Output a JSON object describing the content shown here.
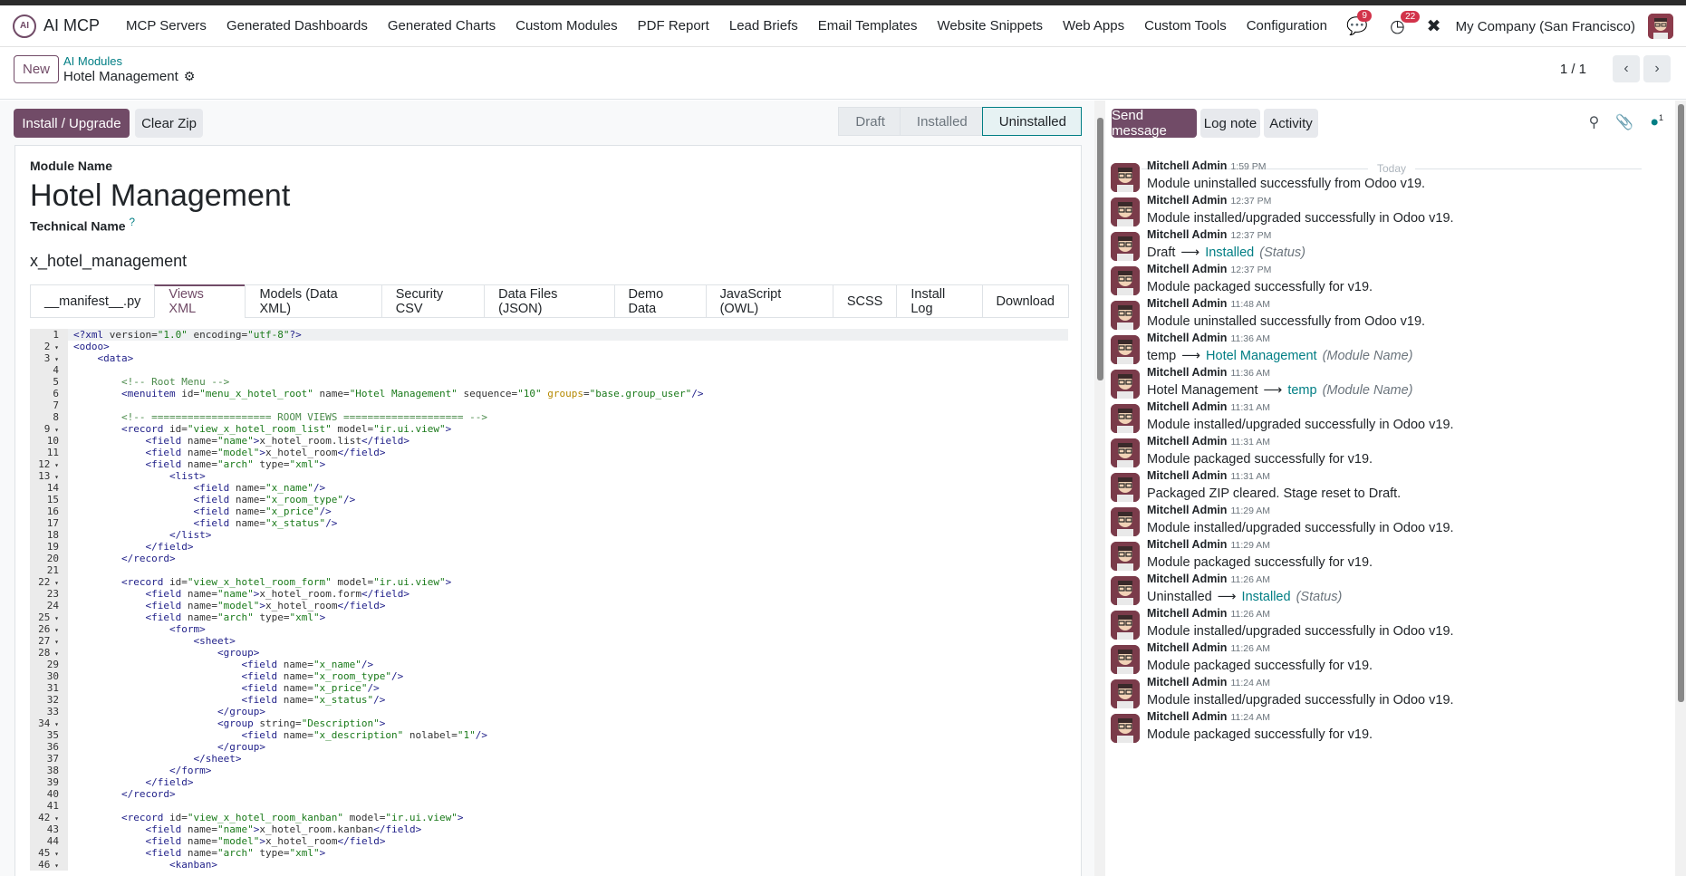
{
  "navbar": {
    "app_name": "AI MCP",
    "menu": [
      "MCP Servers",
      "Generated Dashboards",
      "Generated Charts",
      "Custom Modules",
      "PDF Report",
      "Lead Briefs",
      "Email Templates",
      "Website Snippets",
      "Web Apps",
      "Custom Tools",
      "Configuration"
    ],
    "messages_badge": "9",
    "activities_badge": "22",
    "company": "My Company (San Francisco)"
  },
  "control_panel": {
    "new_label": "New",
    "breadcrumb_parent": "AI Modules",
    "breadcrumb_current": "Hotel Management",
    "pager": "1 / 1"
  },
  "form": {
    "install_label": "Install / Upgrade",
    "clear_zip_label": "Clear Zip",
    "stages": [
      "Draft",
      "Installed",
      "Uninstalled"
    ],
    "active_stage": "Uninstalled",
    "module_name_label": "Module Name",
    "module_name": "Hotel Management",
    "technical_name_label": "Technical Name",
    "technical_name_help": "?",
    "technical_name": "x_hotel_management",
    "tabs": [
      "__manifest__.py",
      "Views XML",
      "Models (Data XML)",
      "Security CSV",
      "Data Files (JSON)",
      "Demo Data",
      "JavaScript (OWL)",
      "SCSS",
      "Install Log",
      "Download"
    ],
    "active_tab": "Views XML"
  },
  "code_lines": [
    "<?xml version=\"1.0\" encoding=\"utf-8\"?>",
    "<odoo>",
    "    <data>",
    "",
    "        <!-- Root Menu -->",
    "        <menuitem id=\"menu_x_hotel_root\" name=\"Hotel Management\" sequence=\"10\" groups=\"base.group_user\"/>",
    "",
    "        <!-- ==================== ROOM VIEWS ==================== -->",
    "        <record id=\"view_x_hotel_room_list\" model=\"ir.ui.view\">",
    "            <field name=\"name\">x_hotel_room.list</field>",
    "            <field name=\"model\">x_hotel_room</field>",
    "            <field name=\"arch\" type=\"xml\">",
    "                <list>",
    "                    <field name=\"x_name\"/>",
    "                    <field name=\"x_room_type\"/>",
    "                    <field name=\"x_price\"/>",
    "                    <field name=\"x_status\"/>",
    "                </list>",
    "            </field>",
    "        </record>",
    "",
    "        <record id=\"view_x_hotel_room_form\" model=\"ir.ui.view\">",
    "            <field name=\"name\">x_hotel_room.form</field>",
    "            <field name=\"model\">x_hotel_room</field>",
    "            <field name=\"arch\" type=\"xml\">",
    "                <form>",
    "                    <sheet>",
    "                        <group>",
    "                            <field name=\"x_name\"/>",
    "                            <field name=\"x_room_type\"/>",
    "                            <field name=\"x_price\"/>",
    "                            <field name=\"x_status\"/>",
    "                        </group>",
    "                        <group string=\"Description\">",
    "                            <field name=\"x_description\" nolabel=\"1\"/>",
    "                        </group>",
    "                    </sheet>",
    "                </form>",
    "            </field>",
    "        </record>",
    "",
    "        <record id=\"view_x_hotel_room_kanban\" model=\"ir.ui.view\">",
    "            <field name=\"name\">x_hotel_room.kanban</field>",
    "            <field name=\"model\">x_hotel_room</field>",
    "            <field name=\"arch\" type=\"xml\">",
    "                <kanban>"
  ],
  "fold_lines": [
    2,
    3,
    9,
    12,
    13,
    22,
    25,
    26,
    27,
    28,
    34,
    42,
    45,
    46
  ],
  "chatter": {
    "send_message": "Send message",
    "log_note": "Log note",
    "activity": "Activity",
    "followers": "1",
    "today": "Today",
    "messages": [
      {
        "author": "Mitchell Admin",
        "time": "1:59 PM",
        "body": "Module uninstalled successfully from Odoo v19."
      },
      {
        "author": "Mitchell Admin",
        "time": "12:37 PM",
        "body": "Module installed/upgraded successfully in Odoo v19."
      },
      {
        "author": "Mitchell Admin",
        "time": "12:37 PM",
        "old": "Draft",
        "new": "Installed",
        "field": "(Status)"
      },
      {
        "author": "Mitchell Admin",
        "time": "12:37 PM",
        "body": "Module packaged successfully for v19."
      },
      {
        "author": "Mitchell Admin",
        "time": "11:48 AM",
        "body": "Module uninstalled successfully from Odoo v19."
      },
      {
        "author": "Mitchell Admin",
        "time": "11:36 AM",
        "old": "temp",
        "new": "Hotel Management",
        "field": "(Module Name)"
      },
      {
        "author": "Mitchell Admin",
        "time": "11:36 AM",
        "old": "Hotel Management",
        "new": "temp",
        "field": "(Module Name)"
      },
      {
        "author": "Mitchell Admin",
        "time": "11:31 AM",
        "body": "Module installed/upgraded successfully in Odoo v19."
      },
      {
        "author": "Mitchell Admin",
        "time": "11:31 AM",
        "body": "Module packaged successfully for v19."
      },
      {
        "author": "Mitchell Admin",
        "time": "11:31 AM",
        "body": "Packaged ZIP cleared. Stage reset to Draft."
      },
      {
        "author": "Mitchell Admin",
        "time": "11:29 AM",
        "body": "Module installed/upgraded successfully in Odoo v19."
      },
      {
        "author": "Mitchell Admin",
        "time": "11:29 AM",
        "body": "Module packaged successfully for v19."
      },
      {
        "author": "Mitchell Admin",
        "time": "11:26 AM",
        "old": "Uninstalled",
        "new": "Installed",
        "field": "(Status)"
      },
      {
        "author": "Mitchell Admin",
        "time": "11:26 AM",
        "body": "Module installed/upgraded successfully in Odoo v19."
      },
      {
        "author": "Mitchell Admin",
        "time": "11:26 AM",
        "body": "Module packaged successfully for v19."
      },
      {
        "author": "Mitchell Admin",
        "time": "11:24 AM",
        "body": "Module installed/upgraded successfully in Odoo v19."
      },
      {
        "author": "Mitchell Admin",
        "time": "11:24 AM",
        "body": "Module packaged successfully for v19."
      }
    ]
  },
  "colors": {
    "brand": "#714b67",
    "link": "#017e84",
    "badge": "#d2334a"
  }
}
